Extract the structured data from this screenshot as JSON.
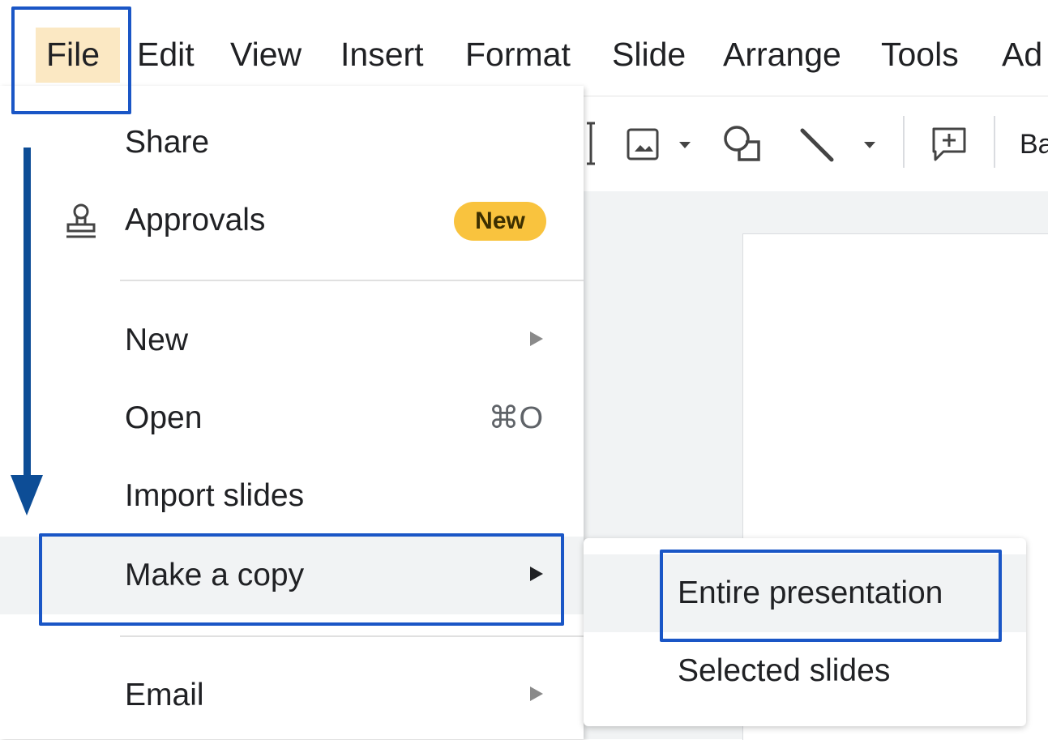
{
  "menubar": {
    "items": [
      "File",
      "Edit",
      "View",
      "Insert",
      "Format",
      "Slide",
      "Arrange",
      "Tools",
      "Ad"
    ]
  },
  "toolbar": {
    "partial_text": "Ba"
  },
  "file_menu": {
    "share": "Share",
    "approvals": "Approvals",
    "approvals_badge": "New",
    "new": "New",
    "open": "Open",
    "open_shortcut": "⌘O",
    "import_slides": "Import slides",
    "make_a_copy": "Make a copy",
    "email": "Email"
  },
  "submenu": {
    "entire_presentation": "Entire presentation",
    "selected_slides": "Selected slides"
  },
  "colors": {
    "highlight_border": "#1a56c6",
    "arrow": "#0d4d96",
    "badge": "#f9c33e",
    "file_active_bg": "#fbe8c3"
  }
}
